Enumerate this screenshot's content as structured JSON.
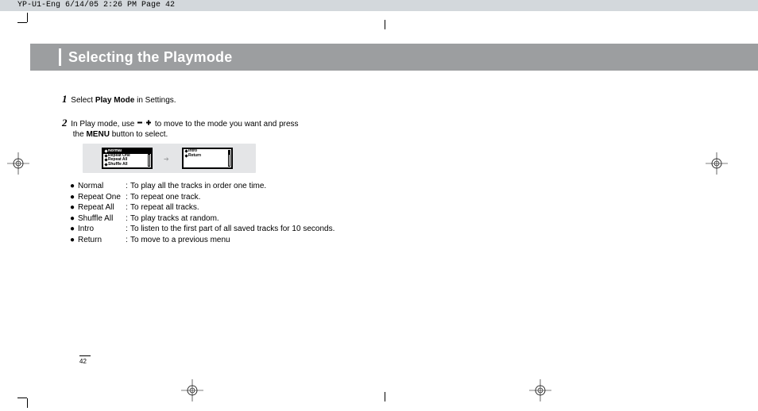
{
  "press_tag": "YP-U1-Eng  6/14/05 2:26 PM  Page 42",
  "title": "Selecting the Playmode",
  "step1": {
    "num": "1",
    "prefix": "Select ",
    "bold": "Play Mode",
    "suffix": " in Settings."
  },
  "step2": {
    "num": "2",
    "line1_a": "In Play mode, use ",
    "line1_b": " to move to the mode you want and press",
    "line2_a": "the ",
    "line2_bold": "MENU",
    "line2_b": " button to select."
  },
  "lcd_left": {
    "r1": "Normal",
    "r2": "Repeat One",
    "r3": "Repeat All",
    "r4": "Shuffle All"
  },
  "lcd_right": {
    "r1": "Intro",
    "r2": "Return"
  },
  "defs": {
    "r1": {
      "term": "Normal",
      "desc": "To play all the tracks in order one time."
    },
    "r2": {
      "term": "Repeat One",
      "desc": "To repeat one track."
    },
    "r3": {
      "term": "Repeat All",
      "desc": "To repeat all tracks."
    },
    "r4": {
      "term": "Shuffle All",
      "desc": "To play tracks at random."
    },
    "r5": {
      "term": "Intro",
      "desc": "To listen to the first part of all saved tracks for 10 seconds."
    },
    "r6": {
      "term": "Return",
      "desc": "To move to a previous menu"
    }
  },
  "page_number": "42",
  "colon": ":",
  "bullet": "●"
}
